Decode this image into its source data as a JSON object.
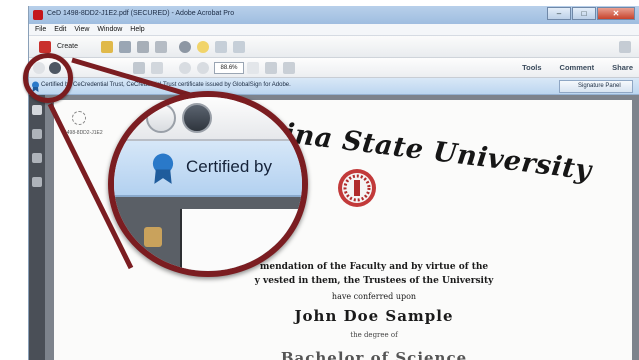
{
  "window": {
    "title": "CeD 1498-8DD2-J1E2.pdf (SECURED) - Adobe Acrobat Pro",
    "controls": {
      "minimize": "–",
      "maximize": "□",
      "close": "✕"
    }
  },
  "menu": [
    "File",
    "Edit",
    "View",
    "Window",
    "Help"
  ],
  "toolbar": {
    "create_label": "Create",
    "zoom_value": "88.6%",
    "links": {
      "tools": "Tools",
      "comment": "Comment",
      "share": "Share"
    }
  },
  "signature_bar": {
    "message": "Certified by CeCredential Trust, CeCredential Trust certificate issued by GlobalSign for Adobe.",
    "panel_button": "Signature Panel"
  },
  "document": {
    "doc_id": "1498-8DD2-J1E2",
    "university": "ina State University",
    "line1": "mendation of the Faculty and by virtue of the",
    "line2": "y vested in them, the Trustees of the University",
    "line3": "have conferred upon",
    "recipient": "John Doe Sample",
    "line5": "the degree of",
    "degree": "Bachelor of Science"
  },
  "magnifier": {
    "certified_text": "Certified by"
  },
  "colors": {
    "lens_ring": "#7b1d21",
    "sig_bar": "#c6ddf3",
    "accent_blue": "#2a79c9"
  }
}
